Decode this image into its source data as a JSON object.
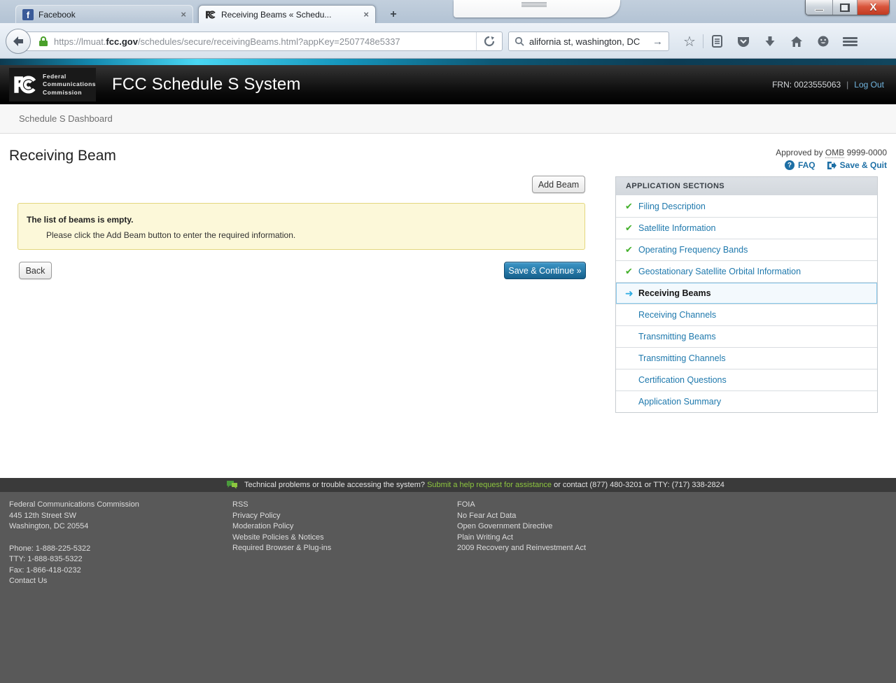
{
  "browser": {
    "tabs": [
      {
        "title": "Facebook",
        "icon": "facebook-icon"
      },
      {
        "title": "Receiving Beams « Schedu...",
        "icon": "fcc-icon",
        "active": true
      }
    ],
    "url": {
      "prefix": "https://lmuat.",
      "domain": "fcc.gov",
      "path": "/schedules/secure/receivingBeams.html?appKey=2507748e5337"
    },
    "search_value": "alifornia st, washington, DC"
  },
  "icons": {
    "close_tab": "×",
    "new_tab": "+",
    "close_window": "x",
    "facebook_f": "f",
    "go_arrow": "→",
    "star": "☆",
    "check": "✔",
    "current_arrow": "➜",
    "question": "?"
  },
  "site_header": {
    "brand_line1": "Federal",
    "brand_line2": "Communications",
    "brand_line3": "Commission",
    "app_title": "FCC Schedule S System",
    "frn": "FRN: 0023555063",
    "separator": "|",
    "logout_label": "Log Out"
  },
  "breadcrumb": {
    "label": "Schedule S Dashboard"
  },
  "page": {
    "title": "Receiving Beam",
    "omb_prefix": "Approved by ",
    "omb_label": "OMB",
    "omb_number": " 9999-0000",
    "faq_label": "FAQ",
    "save_quit_label": "Save & Quit",
    "add_beam_label": "Add Beam",
    "alert_title": "The list of beams is empty.",
    "alert_body": "Please click the Add Beam button to enter the required information.",
    "back_label": "Back",
    "save_continue_label": "Save & Continue »"
  },
  "sections_panel": {
    "header": "APPLICATION SECTIONS",
    "items": [
      {
        "label": "Filing Description",
        "state": "complete"
      },
      {
        "label": "Satellite Information",
        "state": "complete"
      },
      {
        "label": "Operating Frequency Bands",
        "state": "complete"
      },
      {
        "label": "Geostationary Satellite Orbital Information",
        "state": "complete"
      },
      {
        "label": "Receiving Beams",
        "state": "current"
      },
      {
        "label": "Receiving Channels",
        "state": "pending"
      },
      {
        "label": "Transmitting Beams",
        "state": "pending"
      },
      {
        "label": "Transmitting Channels",
        "state": "pending"
      },
      {
        "label": "Certification Questions",
        "state": "pending"
      },
      {
        "label": "Application Summary",
        "state": "pending"
      }
    ]
  },
  "help_bar": {
    "text_before": "Technical problems or trouble accessing the system? ",
    "link_label": "Submit a help request for assistance",
    "text_after": " or contact (877) 480-3201 or TTY: (717) 338-2824"
  },
  "footer": {
    "col1": [
      "Federal Communications Commission",
      "445 12th Street SW",
      "Washington, DC 20554"
    ],
    "col1b": [
      "Phone: 1-888-225-5322",
      "TTY: 1-888-835-5322",
      "Fax: 1-866-418-0232"
    ],
    "contact_us": "Contact Us",
    "col2": [
      "RSS",
      "Privacy Policy",
      "Moderation Policy",
      "Website Policies & Notices",
      "Required Browser & Plug-ins"
    ],
    "col3": [
      "FOIA",
      "No Fear Act Data",
      "Open Government Directive",
      "Plain Writing Act",
      "2009 Recovery and Reinvestment Act"
    ]
  },
  "colors": {
    "accent_cyan": "#49d6f2",
    "link_blue": "#1f79ad",
    "check_green": "#43b02a",
    "current_blue": "#2aabe2",
    "alert_bg": "#fcf8d9",
    "alert_border": "#e3d77f",
    "primary_button": "#15608c",
    "footer_gray": "#595959",
    "help_link_green": "#8dc63f"
  }
}
